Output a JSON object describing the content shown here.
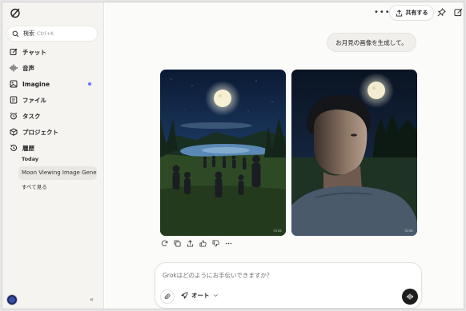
{
  "sidebar": {
    "logo_icon": "grok-logo-icon",
    "search": {
      "label": "検索",
      "shortcut": "Ctrl+K"
    },
    "items": [
      {
        "label": "チャット",
        "icon": "chat-edit-icon"
      },
      {
        "label": "音声",
        "icon": "voice-wave-icon"
      },
      {
        "label": "Imagine",
        "icon": "image-icon"
      },
      {
        "label": "ファイル",
        "icon": "file-icon"
      },
      {
        "label": "タスク",
        "icon": "alarm-icon"
      },
      {
        "label": "プロジェクト",
        "icon": "box-icon"
      },
      {
        "label": "履歴",
        "icon": "history-icon"
      }
    ],
    "history": {
      "section_label": "Today",
      "items": [
        "Moon Viewing Image Gener"
      ],
      "see_all": "すべて見る"
    },
    "collapse_glyph": "«"
  },
  "topbar": {
    "more_glyph": "•••",
    "share_label": "共有する"
  },
  "chat": {
    "user_message": "お月見の画像を生成して。",
    "images": [
      {
        "alt": "Moonlit lakeside scene with people watching the full moon",
        "watermark": "Grok"
      },
      {
        "alt": "Young man looking up at the full moon at night",
        "watermark": "Grok"
      }
    ],
    "actions": [
      "regenerate-icon",
      "copy-icon",
      "share-icon",
      "thumbs-up-icon",
      "thumbs-down-icon",
      "more-icon"
    ]
  },
  "composer": {
    "placeholder": "Grokはどのようにお手伝いできますか？",
    "mode_label": "オート"
  },
  "colors": {
    "sidebar_bg": "#f5f4f1",
    "main_bg": "#fbfbf9",
    "accent_dot": "#6b7bff",
    "voice_button": "#1c1c1c"
  }
}
